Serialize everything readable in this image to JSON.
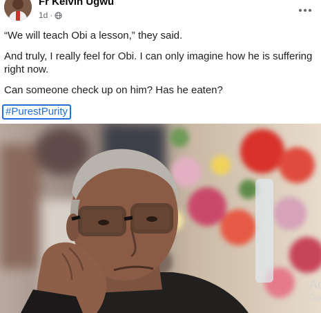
{
  "post": {
    "author": "Fr Kelvin Ugwu",
    "time": "1d",
    "privacy_icon": "globe-icon",
    "menu_icon": "more-options-icon",
    "paragraphs": [
      "“We will teach Obi a lesson,” they said.",
      "And truly, I really feel for Obi. I can only imagine how he is suffering right now.",
      "Can someone check up on him? Has he eaten?"
    ],
    "hashtag": "#PurestPurity"
  },
  "photo": {
    "watermark_line1": "Ac",
    "watermark_line2": "Go"
  },
  "colors": {
    "author_text": "#050505",
    "meta_text": "#65676b",
    "body_text": "#1c1e21",
    "hashtag": "#216fdb"
  }
}
